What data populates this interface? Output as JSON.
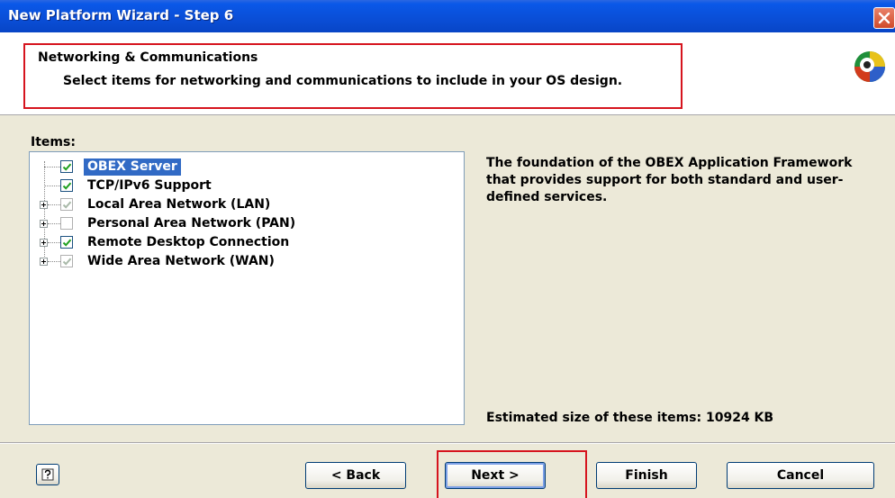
{
  "window": {
    "title": "New Platform Wizard - Step 6",
    "close_icon": "close-x-icon"
  },
  "header": {
    "title": "Networking & Communications",
    "description": "Select items for networking and communications to include in your OS design.",
    "logo_icon": "windows-ce-logo-icon"
  },
  "items": {
    "label": "Items:",
    "rows": [
      {
        "label": "OBEX Server",
        "checked": true,
        "grayed": false,
        "expandable": false,
        "selected": true
      },
      {
        "label": "TCP/IPv6 Support",
        "checked": true,
        "grayed": false,
        "expandable": false,
        "selected": false
      },
      {
        "label": "Local Area Network (LAN)",
        "checked": true,
        "grayed": true,
        "expandable": true,
        "selected": false
      },
      {
        "label": "Personal Area Network (PAN)",
        "checked": false,
        "grayed": false,
        "expandable": true,
        "selected": false
      },
      {
        "label": "Remote Desktop Connection",
        "checked": true,
        "grayed": false,
        "expandable": true,
        "selected": false
      },
      {
        "label": "Wide Area Network (WAN)",
        "checked": true,
        "grayed": true,
        "expandable": true,
        "selected": false
      }
    ]
  },
  "details": {
    "description": "The foundation of the OBEX Application Framework that provides support for both standard and user-defined services.",
    "estimated_size": "Estimated size of these items: 10924 KB"
  },
  "buttons": {
    "help_icon": "help-question-icon",
    "back": "< Back",
    "next": "Next >",
    "finish": "Finish",
    "cancel": "Cancel"
  },
  "colors": {
    "highlight": "#d6141e",
    "selection": "#316ac5",
    "titlebar": "#0a4fd8"
  }
}
